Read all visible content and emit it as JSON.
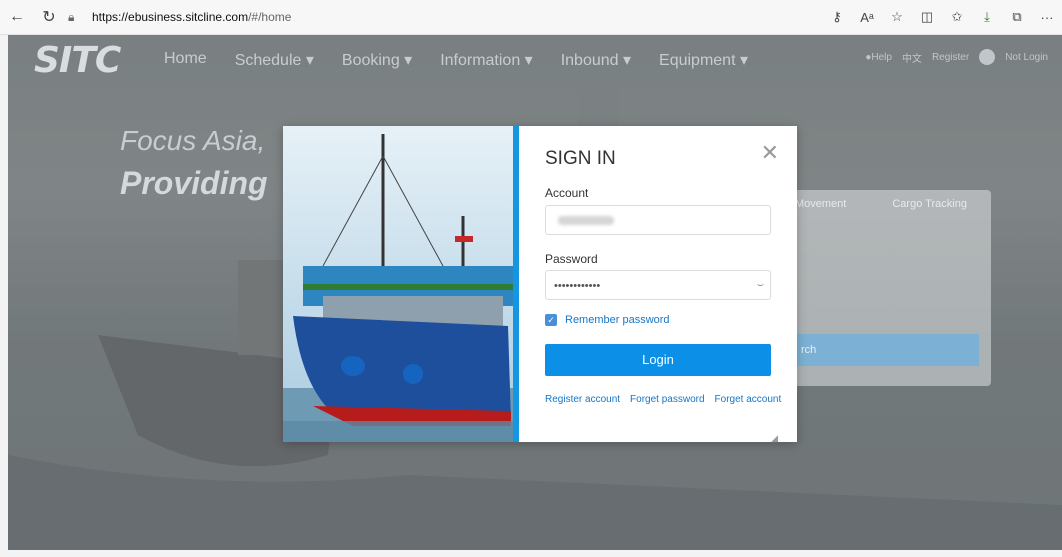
{
  "browser": {
    "url_host": "https://ebusiness.sitcline.com",
    "url_rest": "/#/home",
    "icons": [
      "back-icon",
      "refresh-icon",
      "lock-icon",
      "key-icon",
      "read-aloud-icon",
      "favorite-icon",
      "split-screen-icon",
      "favorites-list-icon",
      "downloads-icon",
      "extensions-icon",
      "more-icon"
    ]
  },
  "site": {
    "logo": "SITC",
    "nav": [
      "Home",
      "Schedule ▾",
      "Booking ▾",
      "Information ▾",
      "Inbound ▾",
      "Equipment ▾"
    ],
    "help": "Help",
    "lang": "中文",
    "register": "Register",
    "not_login": "Not Login",
    "hero_line1": "Focus Asia,",
    "hero_line2": "Providing",
    "tabs": [
      "Movement",
      "Cargo Tracking"
    ],
    "search_label": "rch"
  },
  "modal": {
    "title": "SIGN IN",
    "account_label": "Account",
    "password_label": "Password",
    "password_value": "••••••••••••",
    "remember_label": "Remember password",
    "login_label": "Login",
    "links": [
      "Register account",
      "Forget password",
      "Forget account"
    ]
  },
  "colors": {
    "accent": "#0c8fe6",
    "divider": "#1497e0",
    "link": "#1677c8"
  }
}
